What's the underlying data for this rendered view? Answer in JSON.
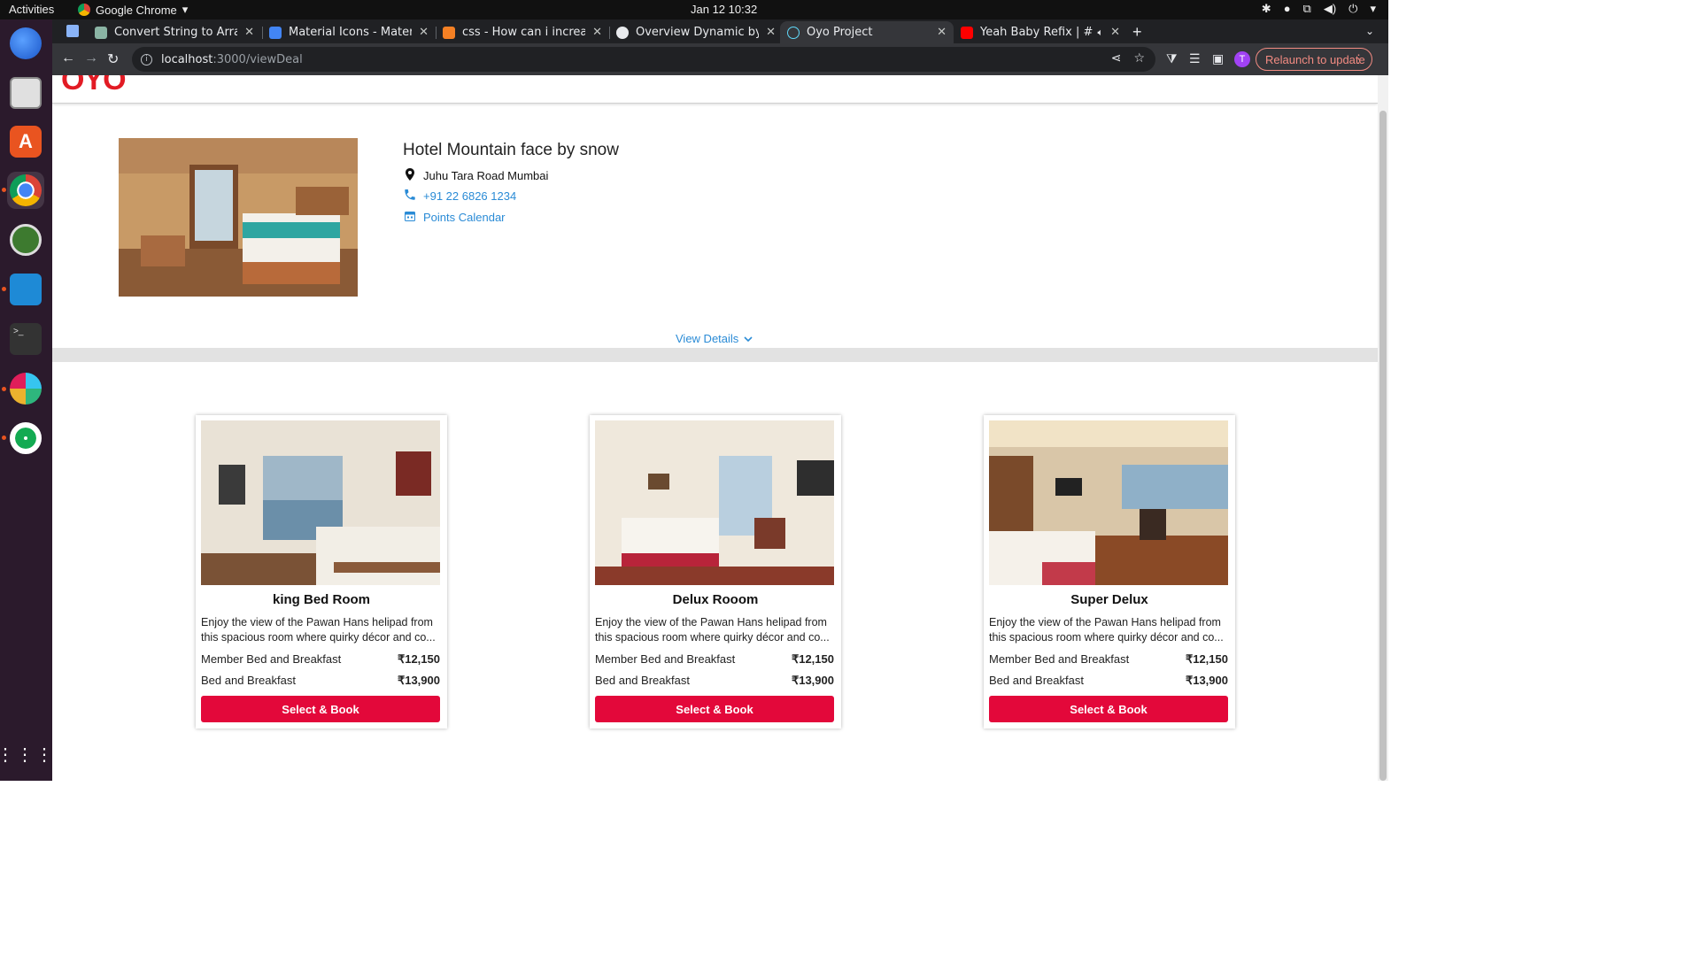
{
  "topbar": {
    "activities": "Activities",
    "app_name": "Google Chrome",
    "clock": "Jan 12  10:32"
  },
  "browser": {
    "tabs": [
      {
        "title": "Convert String to Array",
        "favicon_color": "#8ab4a4"
      },
      {
        "title": "Material Icons - Material U",
        "favicon_color": "#4285f4"
      },
      {
        "title": "css - How can i increase th",
        "favicon_color": "#f48024"
      },
      {
        "title": "Overview Dynamic by Tus",
        "favicon_color": "#e8eaed"
      },
      {
        "title": "Oyo Project",
        "favicon_color": "#61dafb"
      },
      {
        "title": "Yeah Baby Refix | #Ga",
        "favicon_color": "#ff0000"
      }
    ],
    "active_tab_index": 4,
    "url_host": "localhost",
    "url_path": ":3000/viewDeal",
    "relaunch_label": "Relaunch to update",
    "avatar_initial": "T"
  },
  "site": {
    "logo": "OYO"
  },
  "hotel": {
    "name": "Hotel Mountain face by snow",
    "address": "Juhu Tara Road Mumbai",
    "phone": "+91 22 6826 1234",
    "calendar_link": "Points Calendar",
    "view_details": "View Details"
  },
  "rooms": [
    {
      "name": "king Bed Room",
      "description": "Enjoy the view of the Pawan Hans helipad from this spacious room where quirky décor and co...",
      "plans": [
        {
          "label": "Member Bed and Breakfast",
          "price": "₹12,150"
        },
        {
          "label": "Bed and Breakfast",
          "price": "₹13,900"
        }
      ],
      "button": "Select & Book"
    },
    {
      "name": "Delux Rooom",
      "description": "Enjoy the view of the Pawan Hans helipad from this spacious room where quirky décor and co...",
      "plans": [
        {
          "label": "Member Bed and Breakfast",
          "price": "₹12,150"
        },
        {
          "label": "Bed and Breakfast",
          "price": "₹13,900"
        }
      ],
      "button": "Select & Book"
    },
    {
      "name": "Super Delux",
      "description": "Enjoy the view of the Pawan Hans helipad from this spacious room where quirky décor and co...",
      "plans": [
        {
          "label": "Member Bed and Breakfast",
          "price": "₹12,150"
        },
        {
          "label": "Bed and Breakfast",
          "price": "₹13,900"
        }
      ],
      "button": "Select & Book"
    }
  ],
  "colors": {
    "brand": "#e21b24",
    "button": "#e3083a",
    "link": "#2a8bd6"
  }
}
